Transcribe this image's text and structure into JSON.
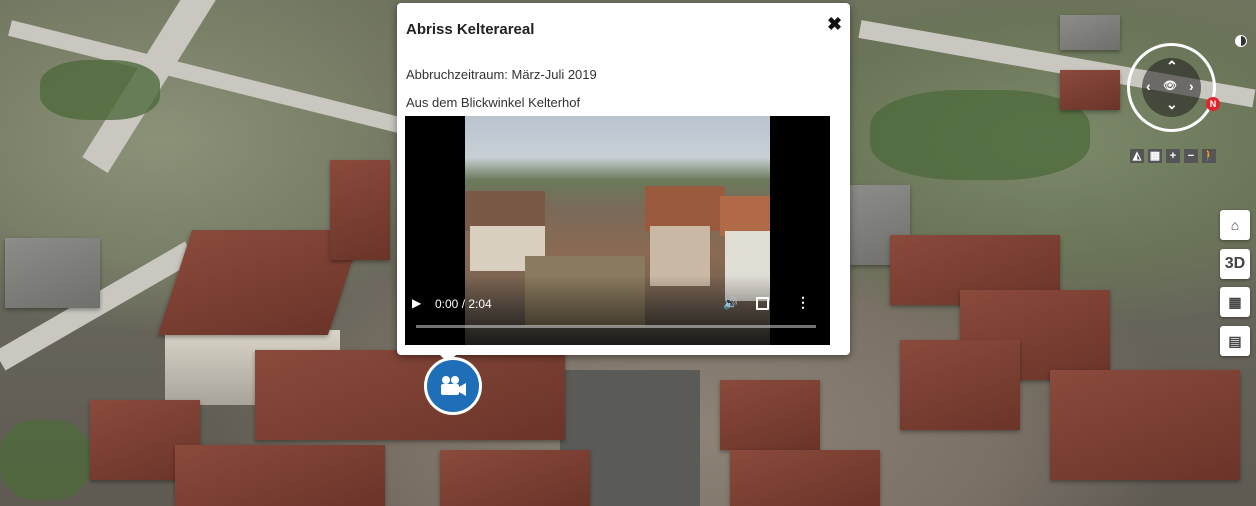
{
  "popup": {
    "title": "Abriss Kelterareal",
    "close_label": "✖",
    "line1": "Abbruchzeitraum: März-Juli 2019",
    "line2": "Aus dem Blickwinkel Kelterhof"
  },
  "video": {
    "play_label": "▶",
    "time": "0:00 / 2:04",
    "volume_label": "🔊",
    "more_label": "⋮",
    "progress": 0.0
  },
  "marker": {
    "icon": "video-camera-icon"
  },
  "navigation": {
    "north_label": "N",
    "arrow_up": "⌃",
    "arrow_down": "⌄",
    "arrow_left": "‹",
    "arrow_right": "›",
    "eye": "👁",
    "tools": [
      "◭",
      "▦",
      "+",
      "−",
      "🚶"
    ]
  },
  "side_buttons": {
    "home": "⌂",
    "three_d": "3D",
    "grid": "▦",
    "map": "▤"
  },
  "colors": {
    "marker_blue": "#1e6fb8",
    "north_red": "#e0262c"
  }
}
